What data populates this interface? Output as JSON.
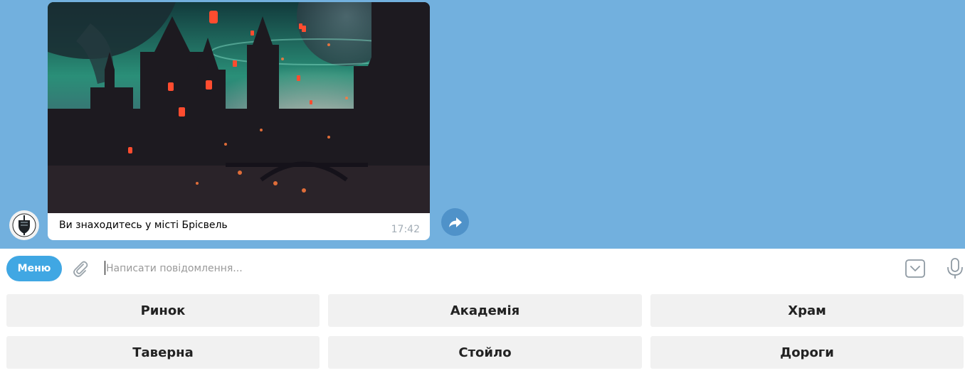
{
  "message": {
    "caption": "Ви знаходитесь у місті Брісвель",
    "time": "17:42"
  },
  "input": {
    "menu_label": "Меню",
    "placeholder": "Написати повідомлення..."
  },
  "keyboard": {
    "rows": [
      [
        "Ринок",
        "Академія",
        "Храм"
      ],
      [
        "Таверна",
        "Стойло",
        "Дороги"
      ]
    ]
  },
  "colors": {
    "chat_background": "#72b0de",
    "accent": "#40a7e3",
    "forward_button": "#4f92c9",
    "keyboard_button": "#f1f1f1"
  },
  "icons": [
    "bot-avatar-icon",
    "forward-icon",
    "paperclip-icon",
    "keyboard-toggle-icon",
    "microphone-icon"
  ]
}
